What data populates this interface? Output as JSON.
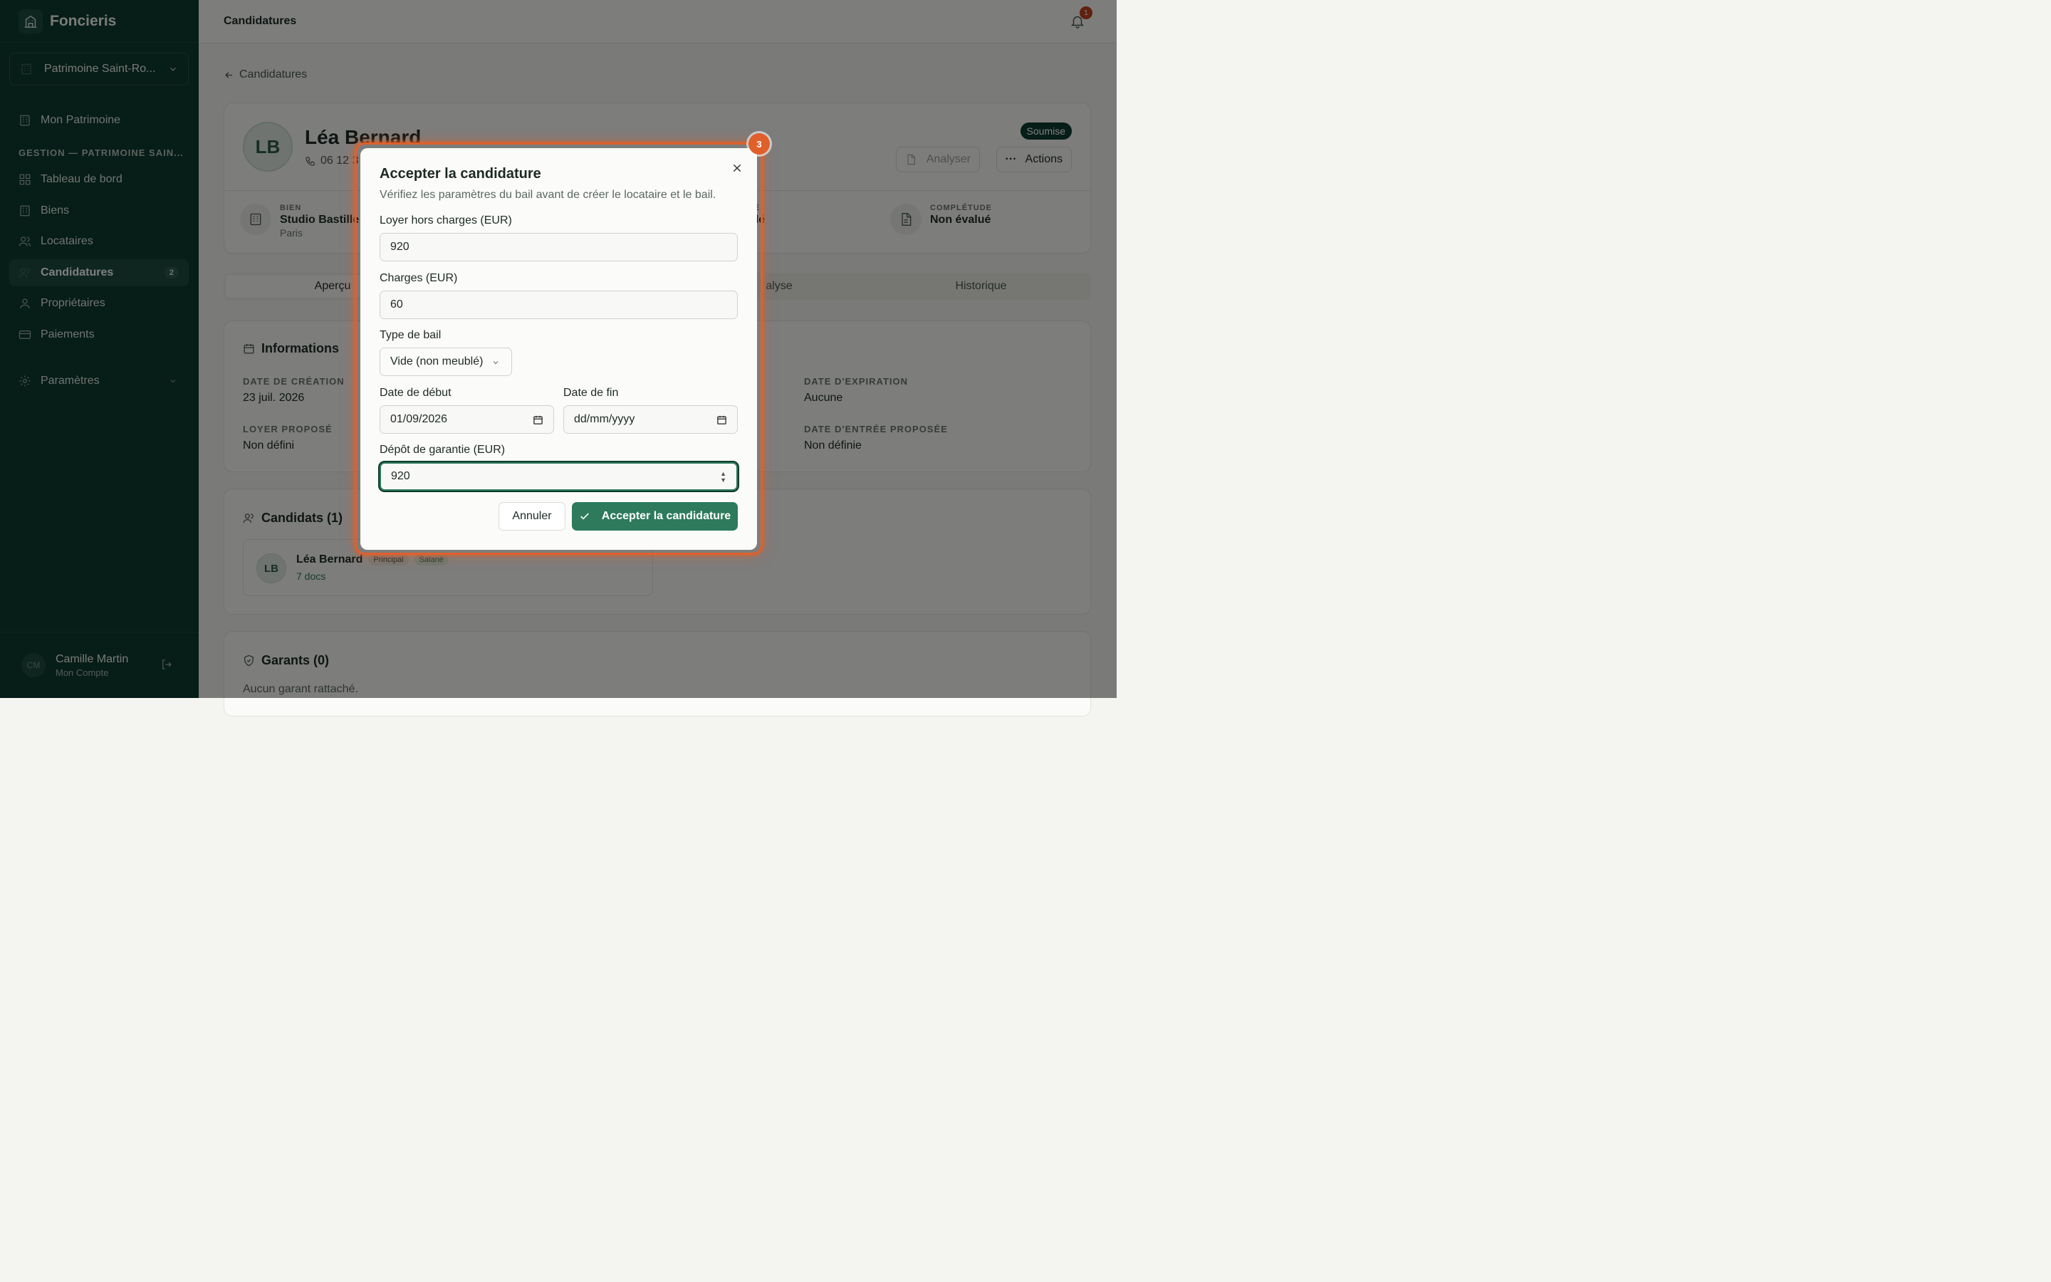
{
  "brand": {
    "name": "Foncieris"
  },
  "workspace": {
    "name": "Patrimoine Saint-Ro..."
  },
  "sidebar": {
    "top_items": [
      {
        "label": "Mon Patrimoine"
      }
    ],
    "section_label": "GESTION — PATRIMOINE SAIN...",
    "items": [
      {
        "label": "Tableau de bord"
      },
      {
        "label": "Biens"
      },
      {
        "label": "Locataires"
      },
      {
        "label": "Candidatures",
        "badge": "2"
      },
      {
        "label": "Propriétaires"
      },
      {
        "label": "Paiements"
      }
    ],
    "settings": {
      "label": "Paramètres"
    },
    "user": {
      "initials": "CM",
      "name": "Camille Martin",
      "subtitle": "Mon Compte"
    }
  },
  "header": {
    "title": "Candidatures",
    "notification_count": "1"
  },
  "breadcrumb": {
    "back_label": "Candidatures"
  },
  "candidate": {
    "initials": "LB",
    "name": "Léa Bernard",
    "phone": "06 12 3",
    "status": "Soumise",
    "analyze_label": "Analyser",
    "actions_label": "Actions"
  },
  "stats": {
    "property": {
      "label": "BIEN",
      "value": "Studio Bastille",
      "sub": "Paris"
    },
    "solvency": {
      "label": "TÉ",
      "value": "ulé"
    },
    "completion": {
      "label": "COMPLÉTUDE",
      "value": "Non évalué"
    }
  },
  "tabs": [
    {
      "label": "Aperçu"
    },
    {
      "label": "alyse"
    },
    {
      "label": "Historique"
    }
  ],
  "informations": {
    "title": "Informations",
    "created_label": "DATE DE CRÉATION",
    "created_value": "23 juil. 2026",
    "rent_label": "LOYER PROPOSÉ",
    "rent_value": "Non défini",
    "expiry_label": "DATE D'EXPIRATION",
    "expiry_value": "Aucune",
    "entry_label": "DATE D'ENTRÉE PROPOSÉE",
    "entry_value": "Non définie"
  },
  "candidats": {
    "title": "Candidats (1)",
    "person": {
      "initials": "LB",
      "name": "Léa Bernard",
      "tag1": "Principal",
      "tag2": "Salarié",
      "docs": "7 docs"
    }
  },
  "garants": {
    "title": "Garants (0)",
    "empty": "Aucun garant rattaché."
  },
  "modal": {
    "step": "3",
    "title": "Accepter la candidature",
    "description": "Vérifiez les paramètres du bail avant de créer le locataire et le bail.",
    "rent_label": "Loyer hors charges (EUR)",
    "rent_value": "920",
    "charges_label": "Charges (EUR)",
    "charges_value": "60",
    "lease_type_label": "Type de bail",
    "lease_type_value": "Vide (non meublé)",
    "start_label": "Date de début",
    "start_value": "01/09/2026",
    "end_label": "Date de fin",
    "end_value": "dd/mm/yyyy",
    "deposit_label": "Dépôt de garantie (EUR)",
    "deposit_value": "920",
    "cancel_label": "Annuler",
    "accept_label": "Accepter la candidature"
  },
  "colors": {
    "sidebar_bg": "#0f3a2e",
    "accent": "#2d7a5d",
    "highlight": "#e0602c"
  }
}
